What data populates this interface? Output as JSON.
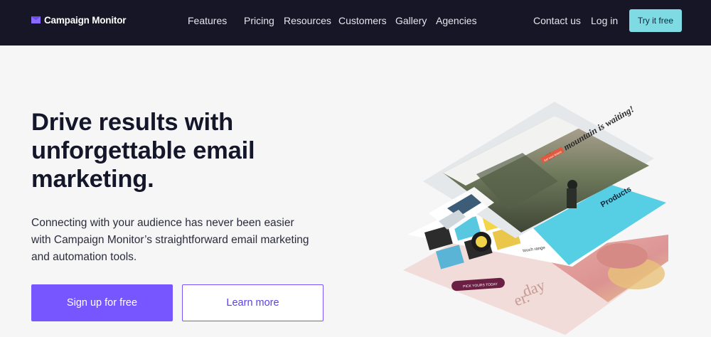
{
  "nav": {
    "logo_text": "Campaign Monitor",
    "links": [
      {
        "label": "Features",
        "has_dropdown": true
      },
      {
        "label": "Pricing"
      },
      {
        "label": "Resources"
      },
      {
        "label": "Customers"
      },
      {
        "label": "Gallery"
      },
      {
        "label": "Agencies"
      }
    ],
    "contact_label": "Contact us",
    "login_label": "Log in",
    "try_label": "Try it free"
  },
  "hero": {
    "headline_lines": [
      "Drive results with",
      "unforgettable email",
      "marketing."
    ],
    "subtext_lines": [
      "Connecting with your audience has never been easier",
      "with Campaign Monitor’s straightforward email marketing",
      "and automation tools."
    ],
    "primary_button": "Sign up for free",
    "secondary_button": "Learn more"
  },
  "illustration": {
    "top_card_heading": "Your mountain is waiting!",
    "products_label": "Products",
    "touch_label": "touch range",
    "day_text": "day",
    "er_text": "er."
  },
  "colors": {
    "nav_bg": "#161626",
    "accent_purple": "#7856ff",
    "accent_teal": "#7edbe4"
  }
}
